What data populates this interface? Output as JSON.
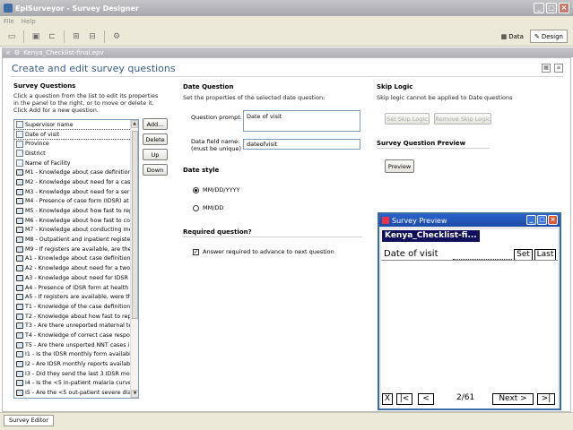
{
  "window": {
    "title": "EpiSurveyor - Survey Designer"
  },
  "menu": {
    "items": [
      "File",
      "Help"
    ]
  },
  "toolbar": {
    "modes": [
      "Data",
      "Design"
    ],
    "active_mode": "Design"
  },
  "doc_tab": {
    "label": "Kenya_Checklist-final.epv"
  },
  "page": {
    "title": "Create and edit survey questions"
  },
  "questions_panel": {
    "title": "Survey Questions",
    "description": "Click a question from the list to edit its properties in the panel to the right, or to move or delete it. Click Add for a new question.",
    "buttons": {
      "add": "Add...",
      "delete": "Delete",
      "up": "Up",
      "down": "Down"
    },
    "items": [
      {
        "label": "Supervisor name",
        "icon": "text-field-icon"
      },
      {
        "label": "Date of visit",
        "icon": "date-field-icon",
        "selected": true
      },
      {
        "label": "Province",
        "icon": "text-field-icon"
      },
      {
        "label": "District",
        "icon": "text-field-icon"
      },
      {
        "label": "Name of Facility",
        "icon": "text-field-icon"
      },
      {
        "label": "M1 - Knowledge about case definition f",
        "icon": "choice-field-icon"
      },
      {
        "label": "M2 - Knowledge about need for a case",
        "icon": "choice-field-icon"
      },
      {
        "label": "M3 - Knowledge about need for a seru",
        "icon": "choice-field-icon"
      },
      {
        "label": "M4 - Presence of case form (IDSR) at",
        "icon": "choice-field-icon"
      },
      {
        "label": "M5 - Knowledge about how fast to rep",
        "icon": "choice-field-icon"
      },
      {
        "label": "M6 - Knowledge about how fast to coll",
        "icon": "choice-field-icon"
      },
      {
        "label": "M7 - Knowledge about conducting mea",
        "icon": "choice-field-icon"
      },
      {
        "label": "M8 - Outpatient and inpatient register",
        "icon": "choice-field-icon"
      },
      {
        "label": "M9 - If registers are available, are the",
        "icon": "choice-field-icon"
      },
      {
        "label": "A1 - Knowledge about case definition f",
        "icon": "choice-field-icon"
      },
      {
        "label": "A2 - Knowledge about need for a two-",
        "icon": "choice-field-icon"
      },
      {
        "label": "A3 - Knowledge about need for IDSR f",
        "icon": "choice-field-icon"
      },
      {
        "label": "A4 - Presence of IDSR form at health f",
        "icon": "choice-field-icon"
      },
      {
        "label": "A5 - If registers are available, were th",
        "icon": "choice-field-icon"
      },
      {
        "label": "T1 - Knowledge of the case definition f",
        "icon": "choice-field-icon"
      },
      {
        "label": "T2 - Knowledge about how fast to repo",
        "icon": "choice-field-icon"
      },
      {
        "label": "T3 - Are there unreported maternal te",
        "icon": "choice-field-icon"
      },
      {
        "label": "T4 - Knowledge of correct case respor",
        "icon": "choice-field-icon"
      },
      {
        "label": "T5 - Are there unsported NNT cases i",
        "icon": "choice-field-icon"
      },
      {
        "label": "I1 - Is the IDSR monthly form available",
        "icon": "choice-field-icon"
      },
      {
        "label": "I2 - Are IDSR monthly reports availabl",
        "icon": "choice-field-icon"
      },
      {
        "label": "I3 - Did they send the last 3 IDSR mon",
        "icon": "choice-field-icon"
      },
      {
        "label": "I4 - Is the <5 in-patient malaria curve",
        "icon": "choice-field-icon"
      },
      {
        "label": "I5 - Are the <5 out-patient severe dia",
        "icon": "choice-field-icon"
      },
      {
        "label": "I6 - Are weekly epidemic monitoring ca",
        "icon": "choice-field-icon"
      }
    ]
  },
  "date_question": {
    "title": "Date Question",
    "description": "Set the properties of the selected date question:",
    "prompt_label": "Question prompt:",
    "prompt_value": "Date of visit",
    "field_label_1": "Data field name:",
    "field_label_2": "(must be unique)",
    "field_value": "dateofvisit",
    "style_title": "Date style",
    "style_options": [
      "MM/DD/YYYY",
      "MM/DD"
    ],
    "style_selected": 0,
    "required_title": "Required question?",
    "required_label": "Answer required to advance to next question",
    "required_checked": true
  },
  "skip_logic": {
    "title": "Skip Logic",
    "description": "Skip logic cannot be applied to Date questions",
    "set_button": "Set Skip Logic",
    "remove_button": "Remove Skip Logic"
  },
  "preview_section": {
    "title": "Survey Question Preview",
    "button": "Preview"
  },
  "preview_window": {
    "title": "Survey Preview",
    "header": "Kenya_Checklist-fi...",
    "question": "Date of visit",
    "set_button": "Set",
    "last_button": "Last",
    "nav": {
      "close": "X",
      "first": "|<",
      "prev": "<",
      "counter": "2/61",
      "next": "Next >",
      "end": ">|"
    }
  },
  "status": {
    "tab": "Survey Editor"
  }
}
